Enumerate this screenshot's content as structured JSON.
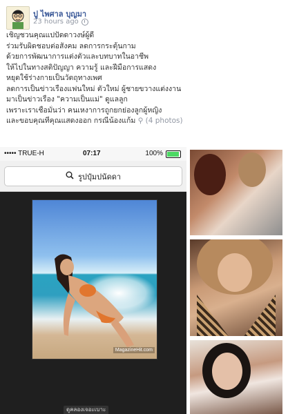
{
  "post": {
    "author": "ปู ไพศาล บุญมา",
    "time": "23 hours ago",
    "lines": [
      "เชิญชวนคุณแปปัดดาวงษ์ผู้ดี",
      "ร่วมรับผิดชอบต่อสังคม ลดการกระตุ้นกาม",
      "ด้วยการพัฒนาการแต่งตัวและบทบาทในอาชีพ",
      "ให้ไปในทางสติปัญญา ความรู้ และฝีมือการแสดง",
      "หยุดใช้ร่างกายเป็นวัตถุทางเพศ",
      "ลดการเป็นข่าวเรื่องแฟนใหม่ ตัวใหม่ ผู้ชายขวางแต่งงาน",
      "มาเป็นข่าวเรื่อง \"ความเป็นแม่\" ดูแลลูก",
      "เพราะเราเชื่อมั่นว่า คนเหงาการถูกยกย่องลูกผู้หญิง",
      "และขอบคุณที่คุณแสดงออก กรณีน้องแก้ม"
    ],
    "photos_label": "(4 photos)"
  },
  "screenshot": {
    "carrier": "••••• TRUE-H",
    "clock": "07:17",
    "battery": "100%",
    "search_text": "รูปปุ๋มปนัดดา",
    "magazine_logo": "MagazineHit.com",
    "tooltip": "ดูคลองเจอะเบาะ"
  }
}
